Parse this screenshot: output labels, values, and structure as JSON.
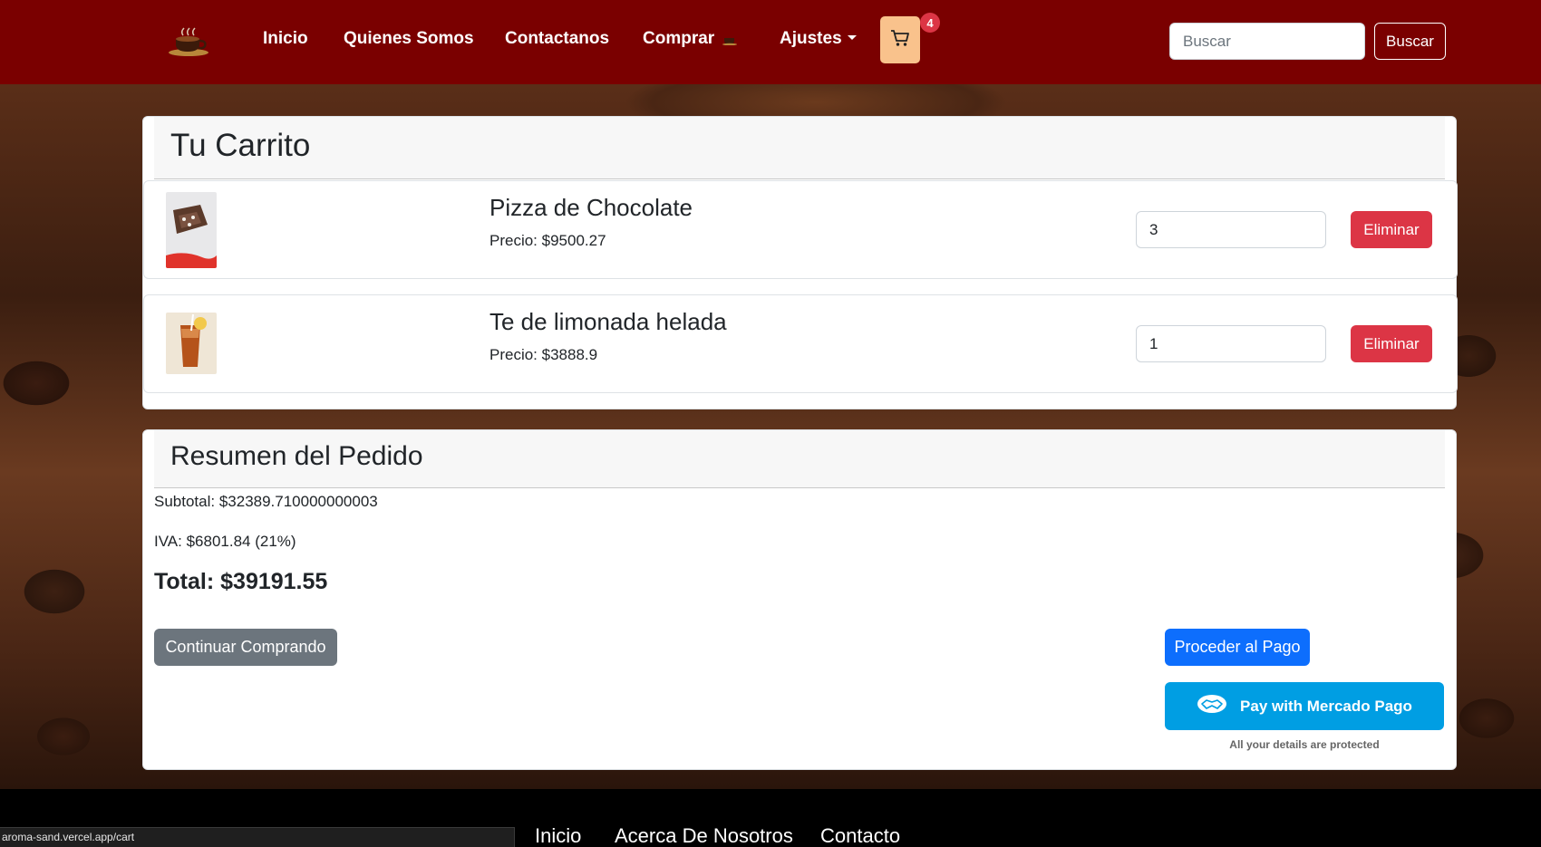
{
  "navbar": {
    "logo": "coffee-cup-logo",
    "links": [
      {
        "label": "Inicio"
      },
      {
        "label": "Quienes Somos"
      },
      {
        "label": "Contactanos"
      },
      {
        "label": "Comprar"
      },
      {
        "label": "Ajustes"
      }
    ],
    "cart_count": "4",
    "search_placeholder": "Buscar",
    "search_button": "Buscar",
    "brand_color": "#7a0000"
  },
  "cart": {
    "title": "Tu Carrito",
    "items": [
      {
        "name": "Pizza de Chocolate",
        "price": "Precio: $9500.27",
        "quantity": "3",
        "remove_label": "Eliminar"
      },
      {
        "name": "Te de limonada helada",
        "price": "Precio: $3888.9",
        "quantity": "1",
        "remove_label": "Eliminar"
      }
    ]
  },
  "summary": {
    "title": "Resumen del Pedido",
    "subtotal": "Subtotal: $32389.710000000003",
    "iva": "IVA: $6801.84 (21%)",
    "total": "Total: $39191.55",
    "continue_button": "Continuar Comprando",
    "checkout_button": "Proceder al Pago",
    "mercado_pago_button": "Pay with Mercado Pago",
    "mercado_pago_note": "All your details are protected"
  },
  "footer": {
    "links": [
      {
        "label": "Inicio"
      },
      {
        "label": "Acerca De Nosotros"
      },
      {
        "label": "Contacto"
      }
    ]
  },
  "status_bar": {
    "url": "aroma-sand.vercel.app/cart"
  },
  "colors": {
    "danger": "#dc3545",
    "primary": "#0d6efd",
    "secondary": "#6c757d",
    "mercado_pago": "#009ee3",
    "cart_button": "#f9c28c"
  }
}
